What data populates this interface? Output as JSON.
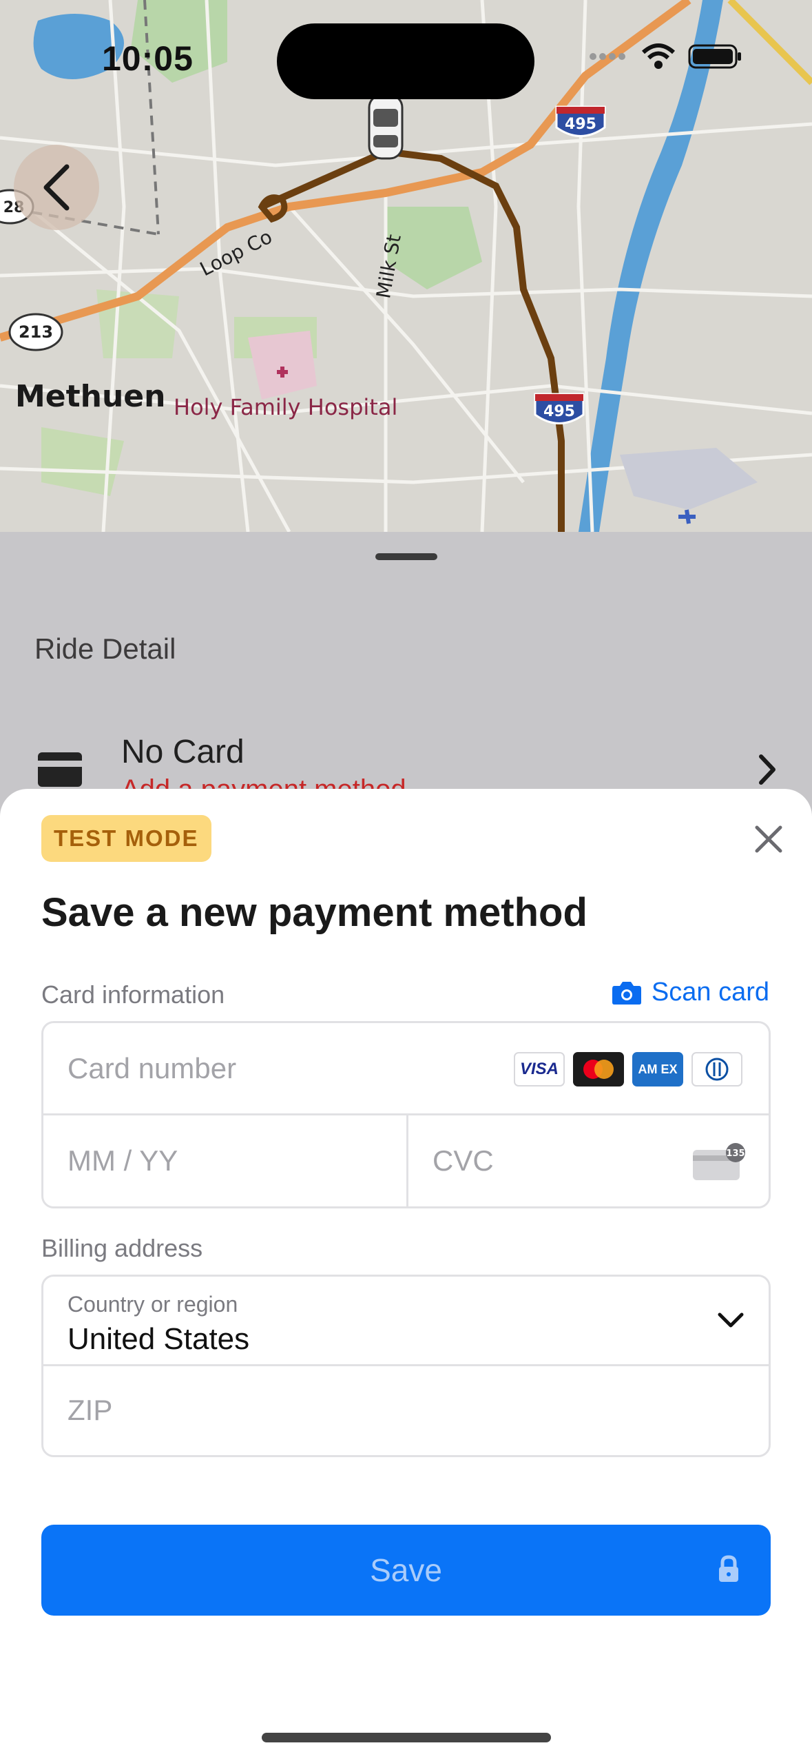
{
  "status_bar": {
    "time": "10:05"
  },
  "map": {
    "places": {
      "town": "Methuen",
      "hospital": "Holy Family Hospital",
      "street_milk": "Milk St",
      "street_loop": "Loop Co"
    },
    "route_shields": [
      "495",
      "495",
      "213",
      "28"
    ]
  },
  "ride_sheet": {
    "title": "Ride Detail",
    "payment_primary": "No Card",
    "payment_secondary": "Add a payment method"
  },
  "payment_sheet": {
    "badge": "TEST MODE",
    "title": "Save a new payment method",
    "card_section_label": "Card information",
    "scan_card_label": "Scan card",
    "card_number_placeholder": "Card number",
    "expiry_placeholder": "MM / YY",
    "cvc_placeholder": "CVC",
    "cvc_hint": "135",
    "brands": [
      "VISA",
      "Mastercard",
      "AMEX",
      "Diners"
    ],
    "brand_labels": {
      "visa": "VISA",
      "amex": "AM EX"
    },
    "billing_label": "Billing address",
    "country_label": "Country or region",
    "country_value": "United States",
    "zip_placeholder": "ZIP",
    "save_label": "Save"
  },
  "colors": {
    "accent": "#0a74f7",
    "badge_bg": "#fcd97e",
    "badge_text": "#a5600b",
    "error": "#c62828",
    "route": "#6b3f10"
  }
}
